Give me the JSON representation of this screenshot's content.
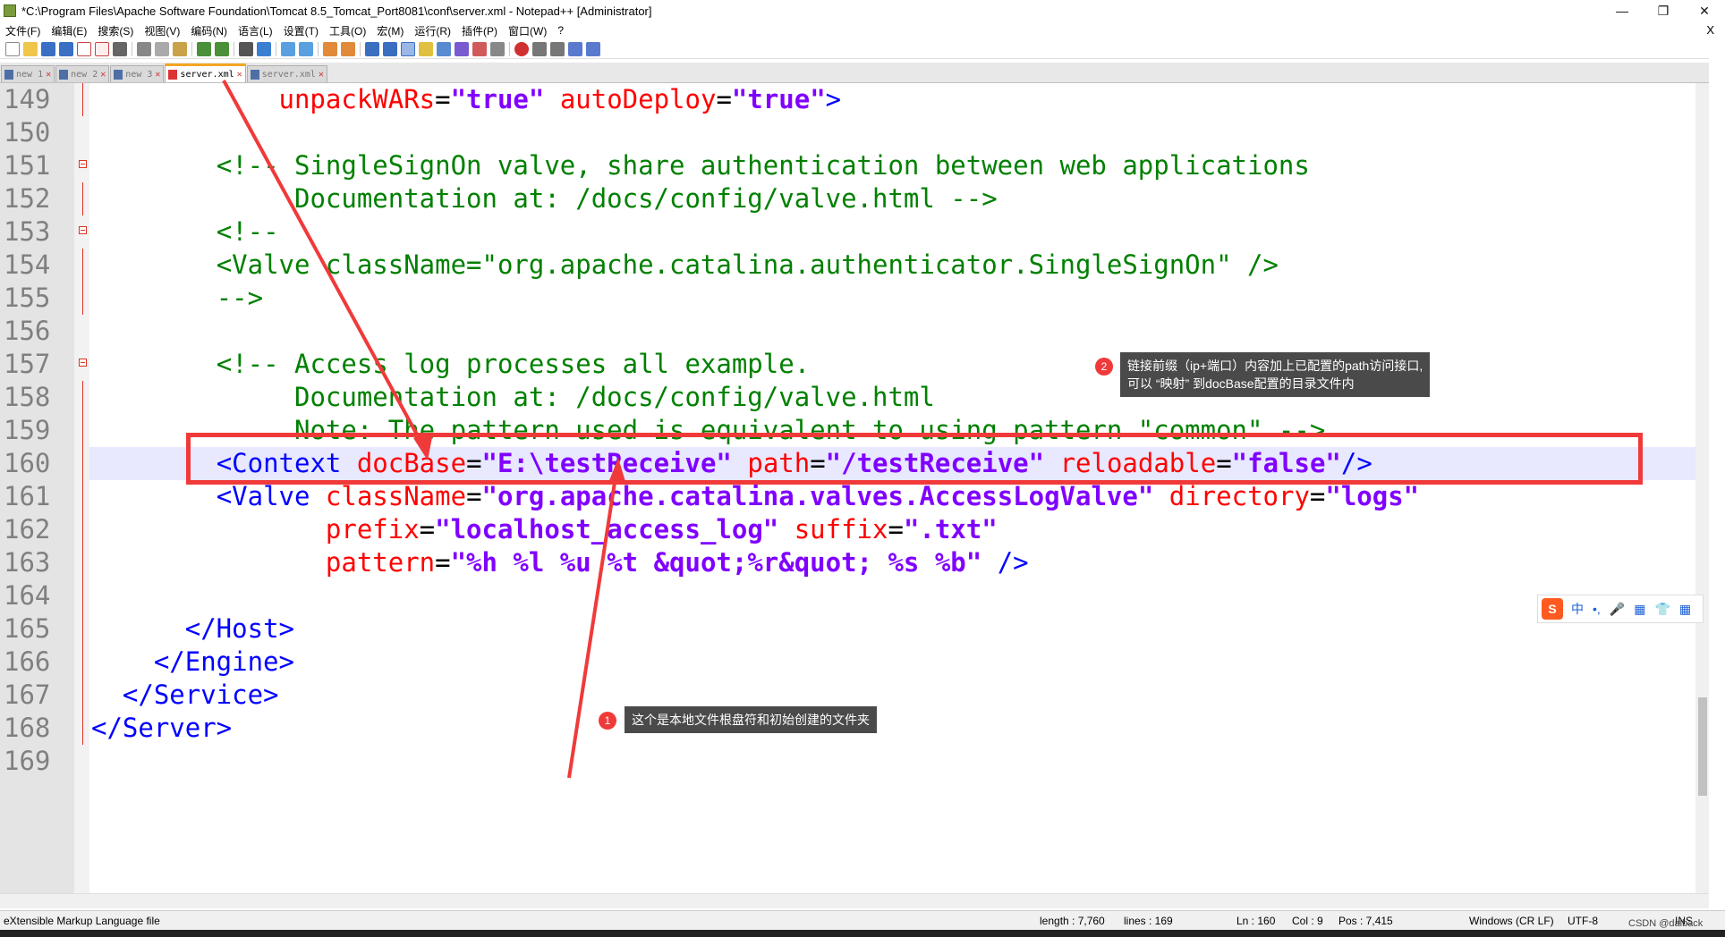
{
  "window": {
    "title": "*C:\\Program Files\\Apache Software Foundation\\Tomcat 8.5_Tomcat_Port8081\\conf\\server.xml - Notepad++ [Administrator]",
    "minimize": "—",
    "restore": "❐",
    "close": "✕"
  },
  "menu": {
    "items": [
      "文件(F)",
      "编辑(E)",
      "搜索(S)",
      "视图(V)",
      "编码(N)",
      "语言(L)",
      "设置(T)",
      "工具(O)",
      "宏(M)",
      "运行(R)",
      "插件(P)",
      "窗口(W)",
      "?"
    ],
    "close_x": "X"
  },
  "tabs": [
    {
      "label": "new 1"
    },
    {
      "label": "new 2"
    },
    {
      "label": "new 3"
    },
    {
      "label": "server.xml"
    },
    {
      "label": "server.xml"
    }
  ],
  "editor": {
    "lines": [
      {
        "num": "149",
        "tokens": [
          {
            "t": "            ",
            "c": "def"
          },
          {
            "t": "unpackWARs",
            "c": "attr"
          },
          {
            "t": "=",
            "c": "def"
          },
          {
            "t": "\"true\"",
            "c": "val"
          },
          {
            "t": " ",
            "c": "def"
          },
          {
            "t": "autoDeploy",
            "c": "attr"
          },
          {
            "t": "=",
            "c": "def"
          },
          {
            "t": "\"true\"",
            "c": "val"
          },
          {
            "t": ">",
            "c": "tag"
          }
        ]
      },
      {
        "num": "150",
        "tokens": []
      },
      {
        "num": "151",
        "tokens": [
          {
            "t": "        ",
            "c": "def"
          },
          {
            "t": "<!-- SingleSignOn valve, share authentication between web applications",
            "c": "com"
          }
        ]
      },
      {
        "num": "152",
        "tokens": [
          {
            "t": "             ",
            "c": "def"
          },
          {
            "t": "Documentation at: /docs/config/valve.html -->",
            "c": "com"
          }
        ]
      },
      {
        "num": "153",
        "tokens": [
          {
            "t": "        ",
            "c": "def"
          },
          {
            "t": "<!--",
            "c": "com"
          }
        ]
      },
      {
        "num": "154",
        "tokens": [
          {
            "t": "        ",
            "c": "def"
          },
          {
            "t": "<Valve className=\"org.apache.catalina.authenticator.SingleSignOn\" />",
            "c": "com"
          }
        ]
      },
      {
        "num": "155",
        "tokens": [
          {
            "t": "        ",
            "c": "def"
          },
          {
            "t": "-->",
            "c": "com"
          }
        ]
      },
      {
        "num": "156",
        "tokens": []
      },
      {
        "num": "157",
        "tokens": [
          {
            "t": "        ",
            "c": "def"
          },
          {
            "t": "<!-- Access log processes all example.",
            "c": "com"
          }
        ]
      },
      {
        "num": "158",
        "tokens": [
          {
            "t": "             ",
            "c": "def"
          },
          {
            "t": "Documentation at: /docs/config/valve.html",
            "c": "com"
          }
        ]
      },
      {
        "num": "159",
        "tokens": [
          {
            "t": "             ",
            "c": "def"
          },
          {
            "t": "Note: The pattern used is equivalent to using pattern \"common\" -->",
            "c": "com"
          }
        ]
      },
      {
        "num": "160",
        "tokens": [
          {
            "t": "        ",
            "c": "def"
          },
          {
            "t": "<Context",
            "c": "tag"
          },
          {
            "t": " ",
            "c": "def"
          },
          {
            "t": "docBase",
            "c": "attr"
          },
          {
            "t": "=",
            "c": "def"
          },
          {
            "t": "\"E:\\testReceive\"",
            "c": "val"
          },
          {
            "t": " ",
            "c": "def"
          },
          {
            "t": "path",
            "c": "attr"
          },
          {
            "t": "=",
            "c": "def"
          },
          {
            "t": "\"/testReceive\"",
            "c": "val"
          },
          {
            "t": " ",
            "c": "def"
          },
          {
            "t": "reloadable",
            "c": "attr"
          },
          {
            "t": "=",
            "c": "def"
          },
          {
            "t": "\"false\"",
            "c": "val"
          },
          {
            "t": "/>",
            "c": "tag"
          }
        ]
      },
      {
        "num": "161",
        "tokens": [
          {
            "t": "        ",
            "c": "def"
          },
          {
            "t": "<Valve",
            "c": "tag"
          },
          {
            "t": " ",
            "c": "def"
          },
          {
            "t": "className",
            "c": "attr"
          },
          {
            "t": "=",
            "c": "def"
          },
          {
            "t": "\"org.apache.catalina.valves.AccessLogValve\"",
            "c": "val"
          },
          {
            "t": " ",
            "c": "def"
          },
          {
            "t": "directory",
            "c": "attr"
          },
          {
            "t": "=",
            "c": "def"
          },
          {
            "t": "\"logs\"",
            "c": "val"
          }
        ]
      },
      {
        "num": "162",
        "tokens": [
          {
            "t": "               ",
            "c": "def"
          },
          {
            "t": "prefix",
            "c": "attr"
          },
          {
            "t": "=",
            "c": "def"
          },
          {
            "t": "\"localhost_access_log\"",
            "c": "val"
          },
          {
            "t": " ",
            "c": "def"
          },
          {
            "t": "suffix",
            "c": "attr"
          },
          {
            "t": "=",
            "c": "def"
          },
          {
            "t": "\".txt\"",
            "c": "val"
          }
        ]
      },
      {
        "num": "163",
        "tokens": [
          {
            "t": "               ",
            "c": "def"
          },
          {
            "t": "pattern",
            "c": "attr"
          },
          {
            "t": "=",
            "c": "def"
          },
          {
            "t": "\"%h %l %u %t &quot;%r&quot; %s %b\"",
            "c": "val"
          },
          {
            "t": " ",
            "c": "def"
          },
          {
            "t": "/>",
            "c": "tag"
          }
        ]
      },
      {
        "num": "164",
        "tokens": []
      },
      {
        "num": "165",
        "tokens": [
          {
            "t": "      ",
            "c": "def"
          },
          {
            "t": "</Host>",
            "c": "tag"
          }
        ]
      },
      {
        "num": "166",
        "tokens": [
          {
            "t": "    ",
            "c": "def"
          },
          {
            "t": "</Engine>",
            "c": "tag"
          }
        ]
      },
      {
        "num": "167",
        "tokens": [
          {
            "t": "  ",
            "c": "def"
          },
          {
            "t": "</Service>",
            "c": "tag"
          }
        ]
      },
      {
        "num": "168",
        "tokens": [
          {
            "t": "</Server>",
            "c": "tag"
          }
        ]
      },
      {
        "num": "169",
        "tokens": []
      }
    ],
    "current_line": "160"
  },
  "annotations": {
    "callout1": {
      "badge": "1",
      "text": "这个是本地文件根盘符和初始创建的文件夹"
    },
    "callout2": {
      "badge": "2",
      "line1": "链接前缀（ip+端口）内容加上已配置的path访问接口,",
      "line2": "可以 “映射” 到docBase配置的目录文件内"
    }
  },
  "ime": {
    "logo": "S",
    "items": [
      "中",
      "•,",
      "🎤",
      "▦",
      "👕",
      "▦"
    ]
  },
  "status": {
    "filetype": "eXtensible Markup Language file",
    "length": "length : 7,760",
    "lines": "lines : 169",
    "ln": "Ln : 160",
    "col": "Col : 9",
    "pos": "Pos : 7,415",
    "eol": "Windows (CR LF)",
    "encoding": "UTF-8",
    "ins": "INS",
    "watermark": "CSDN @dalback"
  },
  "colors": {
    "tag": "#0000ff",
    "attr": "#ff0000",
    "val": "#8000ff",
    "comment": "#008000",
    "highlight": "#f03a3a",
    "current_line": "#e8e8ff"
  }
}
